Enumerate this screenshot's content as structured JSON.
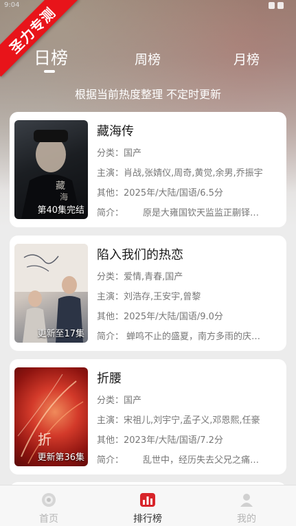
{
  "status": {
    "time": "9:04"
  },
  "ribbon": {
    "text": "圣力专测"
  },
  "tabs": [
    {
      "label": "日榜",
      "active": true
    },
    {
      "label": "周榜",
      "active": false
    },
    {
      "label": "月榜",
      "active": false
    }
  ],
  "subtitle": "根据当前热度整理 不定时更新",
  "labels": {
    "category": "分类：",
    "cast": "主演：",
    "other": "其他：",
    "intro": "简介："
  },
  "items": [
    {
      "title": "藏海传",
      "badge": "第40集完结",
      "category": "国产",
      "cast": "肖战,张婧仪,周奇,黄觉,余男,乔振宇",
      "other": "2025年/大陆/国语/6.5分",
      "intro": "原是大雍国钦天监监正蒯铎…"
    },
    {
      "title": "陷入我们的热恋",
      "badge": "更新至17集",
      "category": "爱情,青春,国产",
      "cast": "刘浩存,王安宇,曾黎",
      "other": "2025年/大陆/国语/9.0分",
      "intro": "蝉鸣不止的盛夏，南方多雨的庆…"
    },
    {
      "title": "折腰",
      "badge": "更新第36集",
      "category": "国产",
      "cast": "宋祖儿,刘宇宁,孟子义,邓恩熙,任豪",
      "other": "2023年/大陆/国语/7.2分",
      "intro": "乱世中，经历失去父兄之痛…"
    }
  ],
  "nav": [
    {
      "label": "首页",
      "icon": "home-icon",
      "active": false
    },
    {
      "label": "排行榜",
      "icon": "ranking-icon",
      "active": true
    },
    {
      "label": "我的",
      "icon": "profile-icon",
      "active": false
    }
  ],
  "colors": {
    "ribbon": "#e8141a",
    "nav_active_icon": "#d8242a"
  }
}
